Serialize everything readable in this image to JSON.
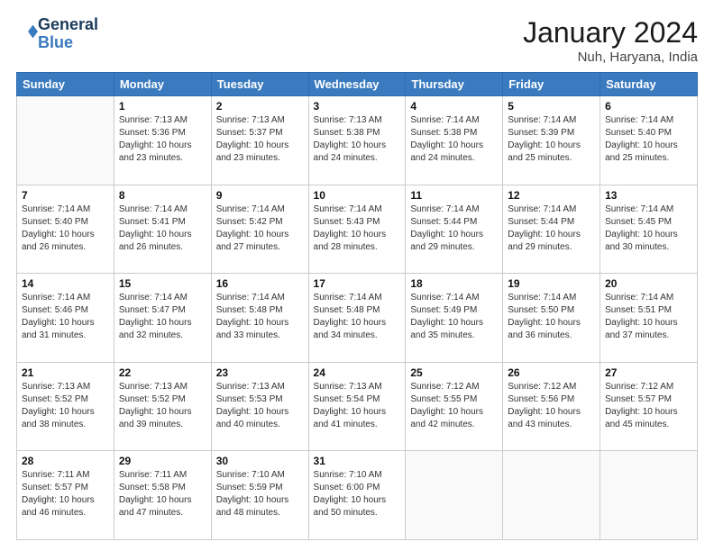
{
  "header": {
    "logo_line1": "General",
    "logo_line2": "Blue",
    "main_title": "January 2024",
    "subtitle": "Nuh, Haryana, India"
  },
  "days_of_week": [
    "Sunday",
    "Monday",
    "Tuesday",
    "Wednesday",
    "Thursday",
    "Friday",
    "Saturday"
  ],
  "weeks": [
    [
      {
        "day": "",
        "info": ""
      },
      {
        "day": "1",
        "info": "Sunrise: 7:13 AM\nSunset: 5:36 PM\nDaylight: 10 hours\nand 23 minutes."
      },
      {
        "day": "2",
        "info": "Sunrise: 7:13 AM\nSunset: 5:37 PM\nDaylight: 10 hours\nand 23 minutes."
      },
      {
        "day": "3",
        "info": "Sunrise: 7:13 AM\nSunset: 5:38 PM\nDaylight: 10 hours\nand 24 minutes."
      },
      {
        "day": "4",
        "info": "Sunrise: 7:14 AM\nSunset: 5:38 PM\nDaylight: 10 hours\nand 24 minutes."
      },
      {
        "day": "5",
        "info": "Sunrise: 7:14 AM\nSunset: 5:39 PM\nDaylight: 10 hours\nand 25 minutes."
      },
      {
        "day": "6",
        "info": "Sunrise: 7:14 AM\nSunset: 5:40 PM\nDaylight: 10 hours\nand 25 minutes."
      }
    ],
    [
      {
        "day": "7",
        "info": "Sunrise: 7:14 AM\nSunset: 5:40 PM\nDaylight: 10 hours\nand 26 minutes."
      },
      {
        "day": "8",
        "info": "Sunrise: 7:14 AM\nSunset: 5:41 PM\nDaylight: 10 hours\nand 26 minutes."
      },
      {
        "day": "9",
        "info": "Sunrise: 7:14 AM\nSunset: 5:42 PM\nDaylight: 10 hours\nand 27 minutes."
      },
      {
        "day": "10",
        "info": "Sunrise: 7:14 AM\nSunset: 5:43 PM\nDaylight: 10 hours\nand 28 minutes."
      },
      {
        "day": "11",
        "info": "Sunrise: 7:14 AM\nSunset: 5:44 PM\nDaylight: 10 hours\nand 29 minutes."
      },
      {
        "day": "12",
        "info": "Sunrise: 7:14 AM\nSunset: 5:44 PM\nDaylight: 10 hours\nand 29 minutes."
      },
      {
        "day": "13",
        "info": "Sunrise: 7:14 AM\nSunset: 5:45 PM\nDaylight: 10 hours\nand 30 minutes."
      }
    ],
    [
      {
        "day": "14",
        "info": "Sunrise: 7:14 AM\nSunset: 5:46 PM\nDaylight: 10 hours\nand 31 minutes."
      },
      {
        "day": "15",
        "info": "Sunrise: 7:14 AM\nSunset: 5:47 PM\nDaylight: 10 hours\nand 32 minutes."
      },
      {
        "day": "16",
        "info": "Sunrise: 7:14 AM\nSunset: 5:48 PM\nDaylight: 10 hours\nand 33 minutes."
      },
      {
        "day": "17",
        "info": "Sunrise: 7:14 AM\nSunset: 5:48 PM\nDaylight: 10 hours\nand 34 minutes."
      },
      {
        "day": "18",
        "info": "Sunrise: 7:14 AM\nSunset: 5:49 PM\nDaylight: 10 hours\nand 35 minutes."
      },
      {
        "day": "19",
        "info": "Sunrise: 7:14 AM\nSunset: 5:50 PM\nDaylight: 10 hours\nand 36 minutes."
      },
      {
        "day": "20",
        "info": "Sunrise: 7:14 AM\nSunset: 5:51 PM\nDaylight: 10 hours\nand 37 minutes."
      }
    ],
    [
      {
        "day": "21",
        "info": "Sunrise: 7:13 AM\nSunset: 5:52 PM\nDaylight: 10 hours\nand 38 minutes."
      },
      {
        "day": "22",
        "info": "Sunrise: 7:13 AM\nSunset: 5:52 PM\nDaylight: 10 hours\nand 39 minutes."
      },
      {
        "day": "23",
        "info": "Sunrise: 7:13 AM\nSunset: 5:53 PM\nDaylight: 10 hours\nand 40 minutes."
      },
      {
        "day": "24",
        "info": "Sunrise: 7:13 AM\nSunset: 5:54 PM\nDaylight: 10 hours\nand 41 minutes."
      },
      {
        "day": "25",
        "info": "Sunrise: 7:12 AM\nSunset: 5:55 PM\nDaylight: 10 hours\nand 42 minutes."
      },
      {
        "day": "26",
        "info": "Sunrise: 7:12 AM\nSunset: 5:56 PM\nDaylight: 10 hours\nand 43 minutes."
      },
      {
        "day": "27",
        "info": "Sunrise: 7:12 AM\nSunset: 5:57 PM\nDaylight: 10 hours\nand 45 minutes."
      }
    ],
    [
      {
        "day": "28",
        "info": "Sunrise: 7:11 AM\nSunset: 5:57 PM\nDaylight: 10 hours\nand 46 minutes."
      },
      {
        "day": "29",
        "info": "Sunrise: 7:11 AM\nSunset: 5:58 PM\nDaylight: 10 hours\nand 47 minutes."
      },
      {
        "day": "30",
        "info": "Sunrise: 7:10 AM\nSunset: 5:59 PM\nDaylight: 10 hours\nand 48 minutes."
      },
      {
        "day": "31",
        "info": "Sunrise: 7:10 AM\nSunset: 6:00 PM\nDaylight: 10 hours\nand 50 minutes."
      },
      {
        "day": "",
        "info": ""
      },
      {
        "day": "",
        "info": ""
      },
      {
        "day": "",
        "info": ""
      }
    ]
  ]
}
